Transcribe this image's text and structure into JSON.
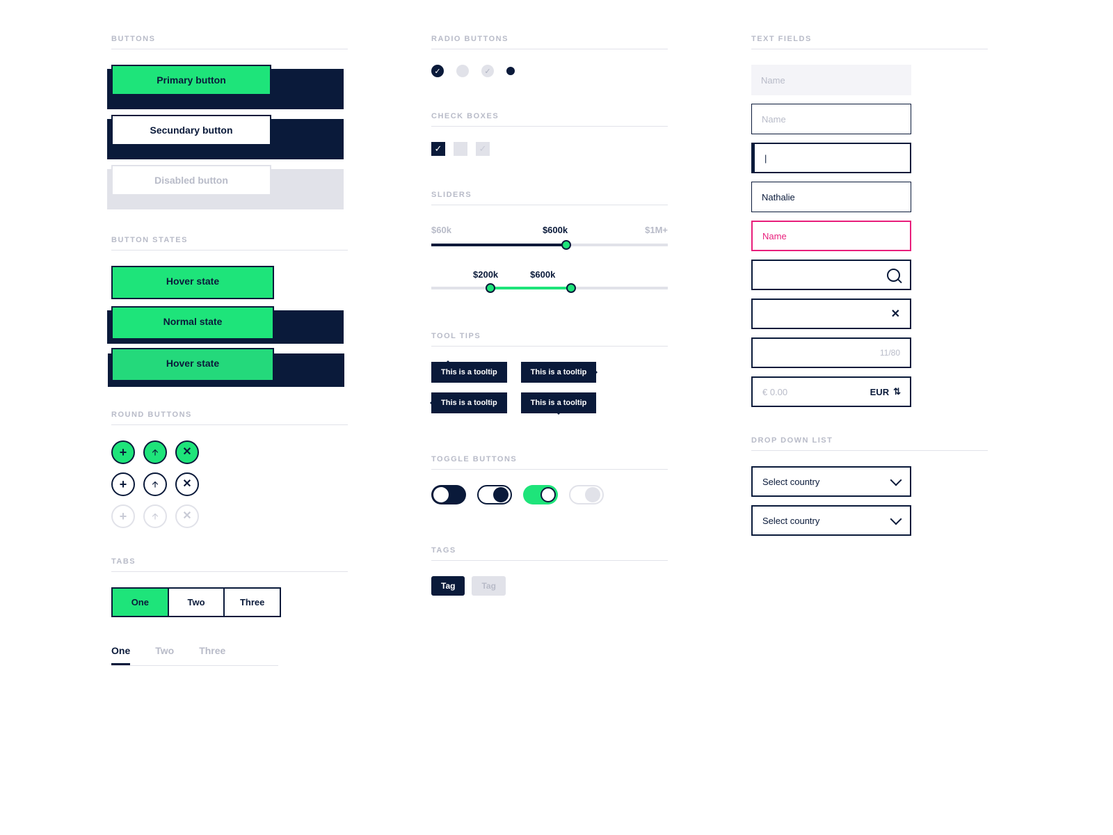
{
  "sections": {
    "buttons": "BUTTONS",
    "button_states": "BUTTON STATES",
    "round_buttons": "ROUND BUTTONS",
    "tabs": "TABS",
    "radio": "RADIO BUTTONS",
    "check": "CHECK BOXES",
    "sliders": "SLIDERS",
    "tooltips": "TOOL TIPS",
    "toggle": "TOGGLE BUTTONS",
    "tags": "TAGS",
    "textfields": "TEXT FIELDS",
    "dropdown": "DROP DOWN LIST"
  },
  "buttons": {
    "primary": "Primary button",
    "secondary": "Secundary button",
    "disabled": "Disabled button"
  },
  "states": {
    "hover1": "Hover state",
    "normal": "Normal state",
    "hover2": "Hover state"
  },
  "tabs": {
    "seg": [
      "One",
      "Two",
      "Three"
    ],
    "line": [
      "One",
      "Two",
      "Three"
    ]
  },
  "slider1": {
    "min": "$60k",
    "mid": "$600k",
    "max": "$1M+"
  },
  "slider2": {
    "a": "$200k",
    "b": "$600k"
  },
  "tooltip": "This is a tooltip",
  "tag": {
    "on": "Tag",
    "off": "Tag"
  },
  "fields": {
    "disabled_ph": "Name",
    "normal_ph": "Name",
    "focus_val": "|",
    "filled_val": "Nathalie",
    "error_val": "Name",
    "count": "11/80",
    "curr_pre": "€  0.00",
    "curr_suf": "EUR"
  },
  "dropdown": {
    "label": "Select country"
  }
}
